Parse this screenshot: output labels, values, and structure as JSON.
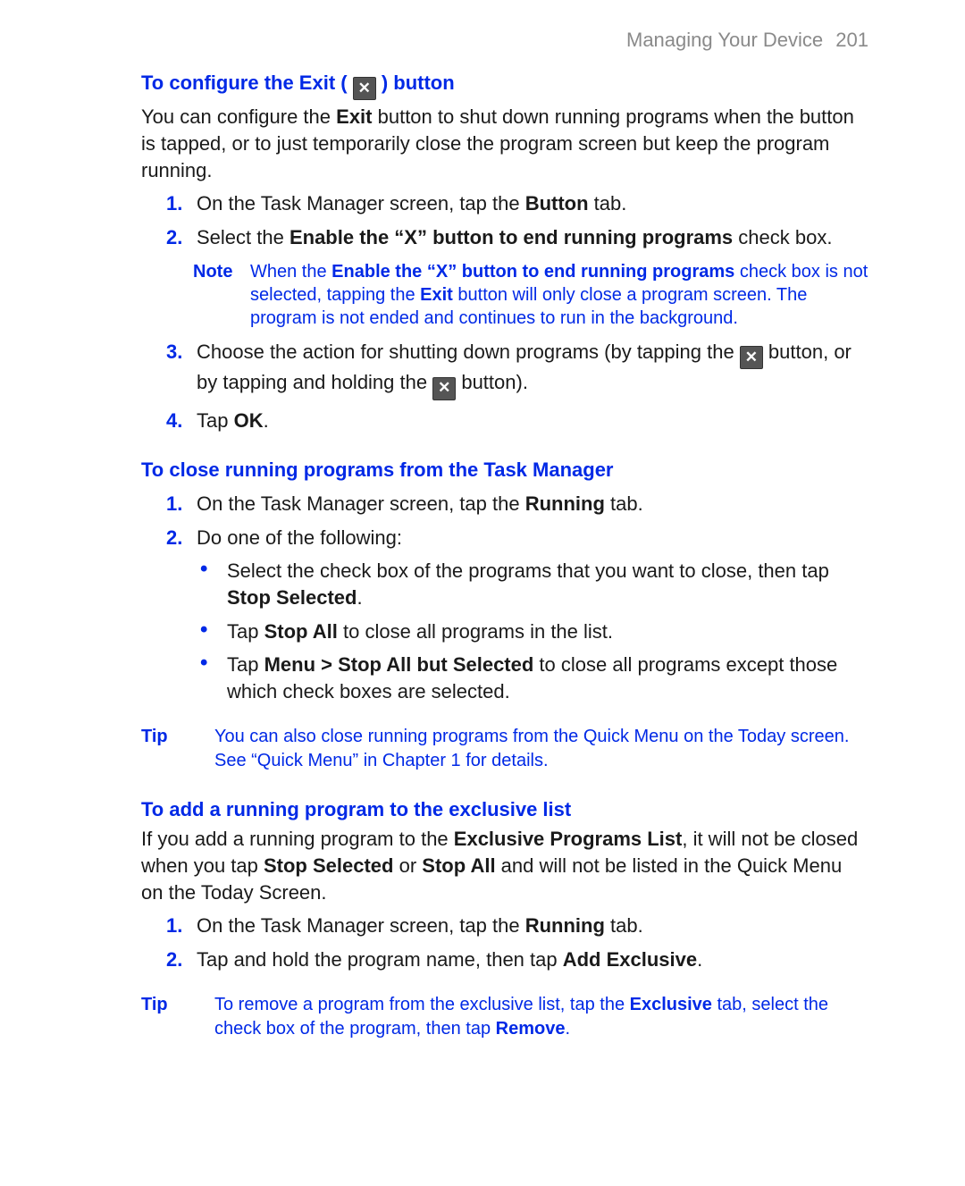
{
  "header": {
    "section": "Managing Your Device",
    "page": "201"
  },
  "s1": {
    "heading_a": "To configure the Exit ( ",
    "heading_b": " ) button",
    "intro_a": "You can configure the ",
    "intro_bold": "Exit",
    "intro_b": " button to shut down running programs when the button is tapped, or to just temporarily close the program screen but keep the program running.",
    "step1_a": "On the Task Manager screen, tap the ",
    "step1_bold": "Button",
    "step1_b": " tab.",
    "step2_a": "Select the ",
    "step2_bold": "Enable the “X” button to end running programs",
    "step2_b": " check box.",
    "note_tag": "Note",
    "note_a": "When the ",
    "note_bold1": "Enable the “X” button to end running programs",
    "note_b": " check box is not selected, tapping the ",
    "note_bold2": "Exit",
    "note_c": " button will only close a program screen. The program is not ended and continues to run in the background.",
    "step3_a": "Choose the action for shutting down programs (by tapping the ",
    "step3_b": " button, or by tapping and holding the ",
    "step3_c": " button).",
    "step4_a": "Tap ",
    "step4_bold": "OK",
    "step4_b": "."
  },
  "s2": {
    "heading": "To close running programs from the Task Manager",
    "step1_a": "On the Task Manager screen, tap the ",
    "step1_bold": "Running",
    "step1_b": " tab.",
    "step2": "Do one of the following:",
    "b1_a": "Select the check box of the programs that you want to close, then tap ",
    "b1_bold": "Stop Selected",
    "b1_b": ".",
    "b2_a": "Tap ",
    "b2_bold": "Stop All",
    "b2_b": " to close all programs in the list.",
    "b3_a": "Tap ",
    "b3_bold": "Menu > Stop All but Selected",
    "b3_b": " to close all programs except those which check boxes are selected.",
    "tip_tag": "Tip",
    "tip": "You can also close running programs from the Quick Menu on the Today screen. See “Quick Menu” in Chapter 1 for details."
  },
  "s3": {
    "heading": "To add a running program to the exclusive list",
    "intro_a": "If you add a running program to the ",
    "intro_bold1": "Exclusive Programs List",
    "intro_b": ", it will not be closed when you tap ",
    "intro_bold2": "Stop Selected",
    "intro_c": " or ",
    "intro_bold3": "Stop All",
    "intro_d": " and will not be listed in the Quick Menu on the Today Screen.",
    "step1_a": "On the Task Manager screen, tap the ",
    "step1_bold": "Running",
    "step1_b": " tab.",
    "step2_a": "Tap and hold the program name, then tap ",
    "step2_bold": "Add Exclusive",
    "step2_b": ".",
    "tip_tag": "Tip",
    "tip_a": "To remove a program from the exclusive list, tap the ",
    "tip_bold1": "Exclusive",
    "tip_b": " tab, select the check box of the program, then tap ",
    "tip_bold2": "Remove",
    "tip_c": "."
  },
  "numbers": {
    "n1": "1.",
    "n2": "2.",
    "n3": "3.",
    "n4": "4."
  },
  "bullet": "•",
  "x_glyph": "✕"
}
